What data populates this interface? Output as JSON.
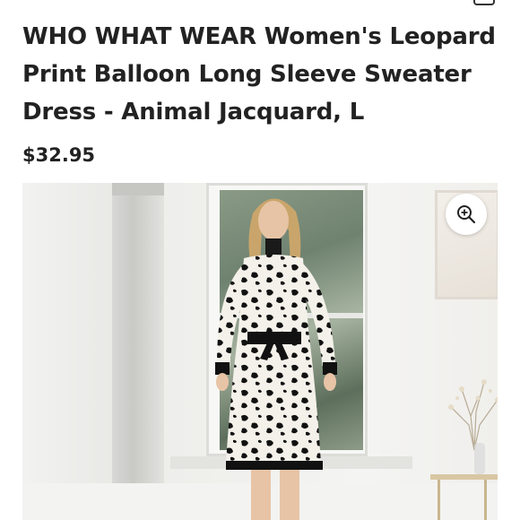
{
  "product": {
    "title": "WHO WHAT WEAR Women's Leopard Print Balloon Long Sleeve Sweater Dress - Animal Jacquard, L",
    "price": "$32.95"
  },
  "image": {
    "zoom_icon": "zoom-in-icon",
    "alt": "Woman wearing black and white leopard print balloon sleeve sweater dress with black belt"
  }
}
